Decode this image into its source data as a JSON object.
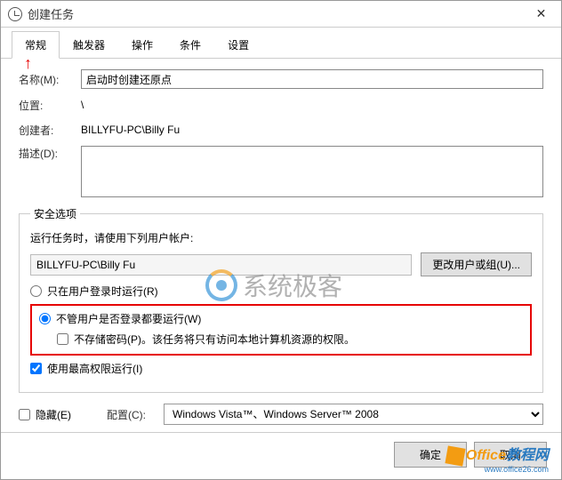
{
  "title": "创建任务",
  "tabs": [
    "常规",
    "触发器",
    "操作",
    "条件",
    "设置"
  ],
  "form": {
    "name_label": "名称(M):",
    "name_value": "启动时创建还原点",
    "location_label": "位置:",
    "location_value": "\\",
    "author_label": "创建者:",
    "author_value": "BILLYFU-PC\\Billy Fu",
    "desc_label": "描述(D):"
  },
  "security": {
    "legend": "安全选项",
    "use_account": "运行任务时，请使用下列用户帐户:",
    "user": "BILLYFU-PC\\Billy Fu",
    "change_user_btn": "更改用户或组(U)...",
    "radio_logged_on": "只在用户登录时运行(R)",
    "radio_always": "不管用户是否登录都要运行(W)",
    "no_password": "不存储密码(P)。该任务将只有访问本地计算机资源的权限。",
    "highest_priv": "使用最高权限运行(I)"
  },
  "bottom": {
    "hidden": "隐藏(E)",
    "config_label": "配置(C):",
    "config_value": "Windows Vista™、Windows Server™ 2008"
  },
  "footer": {
    "ok": "确定",
    "cancel": "取消"
  },
  "watermark1": "系统极客",
  "watermark2a": "Office",
  "watermark2b": "教程网",
  "watermark2c": "www.office26.com"
}
